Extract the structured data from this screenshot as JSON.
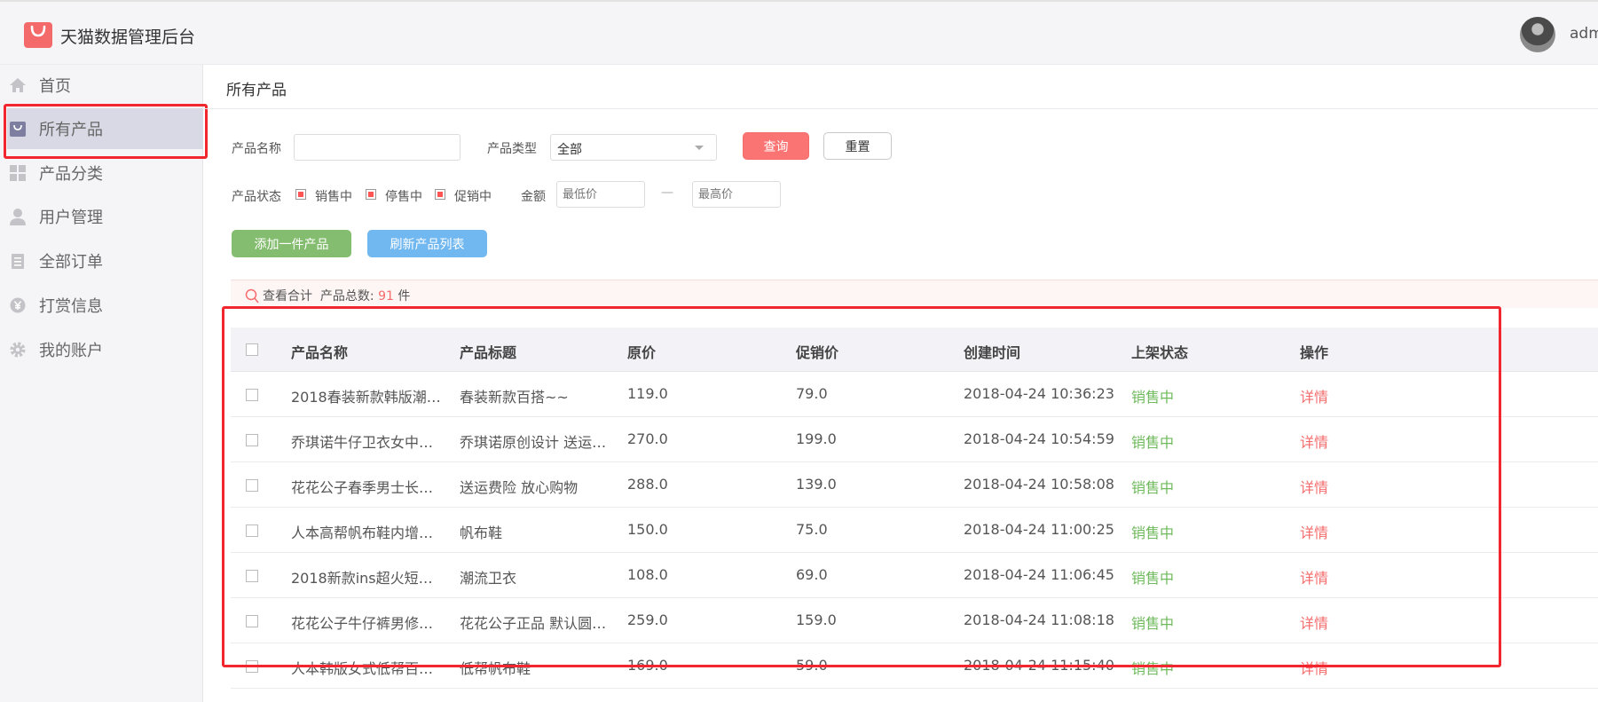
{
  "app": {
    "title": "天猫数据管理后台",
    "username": "adm"
  },
  "sidebar": {
    "items": [
      {
        "label": "首页",
        "icon": "home-icon"
      },
      {
        "label": "所有产品",
        "icon": "bag-icon",
        "active": true
      },
      {
        "label": "产品分类",
        "icon": "grid-icon"
      },
      {
        "label": "用户管理",
        "icon": "user-icon"
      },
      {
        "label": "全部订单",
        "icon": "clipboard-icon"
      },
      {
        "label": "打赏信息",
        "icon": "yen-icon"
      },
      {
        "label": "我的账户",
        "icon": "gear-icon"
      }
    ]
  },
  "page": {
    "title": "所有产品"
  },
  "filters": {
    "name_label": "产品名称",
    "name_value": "",
    "type_label": "产品类型",
    "type_value": "全部",
    "query_button": "查询",
    "reset_button": "重置",
    "status_label": "产品状态",
    "status_options": [
      "销售中",
      "停售中",
      "促销中"
    ],
    "amount_label": "金额",
    "min_placeholder": "最低价",
    "max_placeholder": "最高价",
    "range_dash": "—"
  },
  "actions": {
    "add_button": "添加一件产品",
    "refresh_button": "刷新产品列表"
  },
  "summary": {
    "view_total": "查看合计",
    "count_label": "产品总数:",
    "count": "91",
    "unit": "件"
  },
  "table": {
    "columns": [
      "产品名称",
      "产品标题",
      "原价",
      "促销价",
      "创建时间",
      "上架状态",
      "操作"
    ],
    "rows": [
      {
        "name": "2018春装新款韩版潮…",
        "title": "春装新款百搭~~",
        "price": "119.0",
        "promo": "79.0",
        "created": "2018-04-24 10:36:23",
        "status": "销售中",
        "op": "详情"
      },
      {
        "name": "乔琪诺牛仔卫衣女中…",
        "title": "乔琪诺原创设计 送运…",
        "price": "270.0",
        "promo": "199.0",
        "created": "2018-04-24 10:54:59",
        "status": "销售中",
        "op": "详情"
      },
      {
        "name": "花花公子春季男士长…",
        "title": "送运费险 放心购物",
        "price": "288.0",
        "promo": "139.0",
        "created": "2018-04-24 10:58:08",
        "status": "销售中",
        "op": "详情"
      },
      {
        "name": "人本高帮帆布鞋内增…",
        "title": "帆布鞋",
        "price": "150.0",
        "promo": "75.0",
        "created": "2018-04-24 11:00:25",
        "status": "销售中",
        "op": "详情"
      },
      {
        "name": "2018新款ins超火短…",
        "title": "潮流卫衣",
        "price": "108.0",
        "promo": "69.0",
        "created": "2018-04-24 11:06:45",
        "status": "销售中",
        "op": "详情"
      },
      {
        "name": "花花公子牛仔裤男修…",
        "title": "花花公子正品 默认圆…",
        "price": "259.0",
        "promo": "159.0",
        "created": "2018-04-24 11:08:18",
        "status": "销售中",
        "op": "详情"
      },
      {
        "name": "人本韩版女式低帮百…",
        "title": "低帮帆布鞋",
        "price": "169.0",
        "promo": "59.0",
        "created": "2018-04-24 11:15:40",
        "status": "销售中",
        "op": "详情"
      }
    ]
  },
  "colors": {
    "accent_red": "#f56c6c",
    "success_green": "#6fba5c",
    "highlight_box": "#f2262f"
  }
}
